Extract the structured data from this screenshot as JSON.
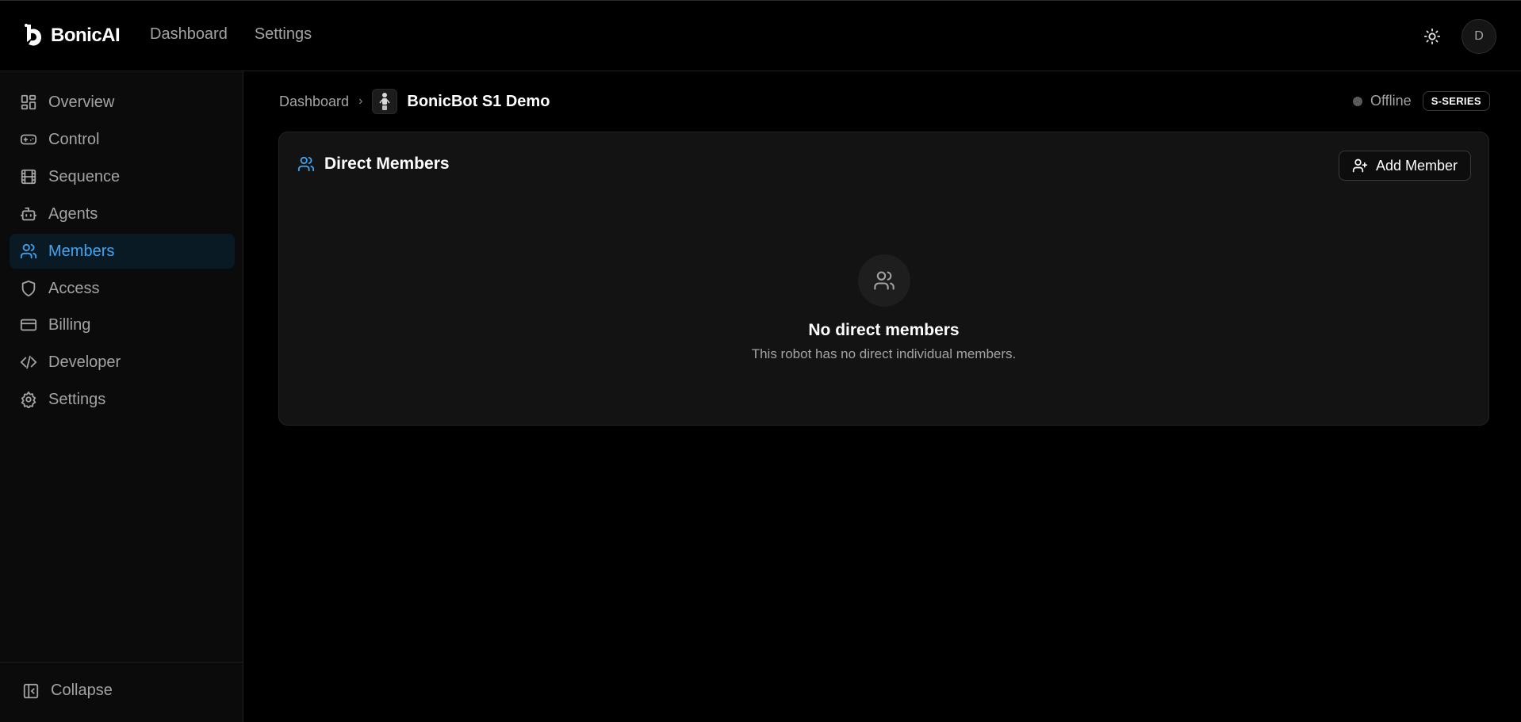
{
  "app": {
    "brand_name": "BonicAI",
    "accent_color": "#3ea6f5"
  },
  "topnav": {
    "items": [
      {
        "label": "Dashboard"
      },
      {
        "label": "Settings"
      }
    ]
  },
  "user": {
    "avatar_initial": "D"
  },
  "sidebar": {
    "items": [
      {
        "label": "Overview",
        "icon": "grid-icon",
        "active": false
      },
      {
        "label": "Control",
        "icon": "gamepad-icon",
        "active": false
      },
      {
        "label": "Sequence",
        "icon": "film-icon",
        "active": false
      },
      {
        "label": "Agents",
        "icon": "bot-icon",
        "active": false
      },
      {
        "label": "Members",
        "icon": "users-icon",
        "active": true
      },
      {
        "label": "Access",
        "icon": "shield-icon",
        "active": false
      },
      {
        "label": "Billing",
        "icon": "credit-card-icon",
        "active": false
      },
      {
        "label": "Developer",
        "icon": "code-icon",
        "active": false
      },
      {
        "label": "Settings",
        "icon": "gear-icon",
        "active": false
      }
    ],
    "collapse_label": "Collapse"
  },
  "breadcrumb": {
    "parent": "Dashboard",
    "current": "BonicBot S1 Demo"
  },
  "robot_status": {
    "status": "Offline",
    "series": "S-SERIES"
  },
  "members_card": {
    "title": "Direct Members",
    "add_button_label": "Add Member",
    "empty_title": "No direct members",
    "empty_description": "This robot has no direct individual members."
  }
}
